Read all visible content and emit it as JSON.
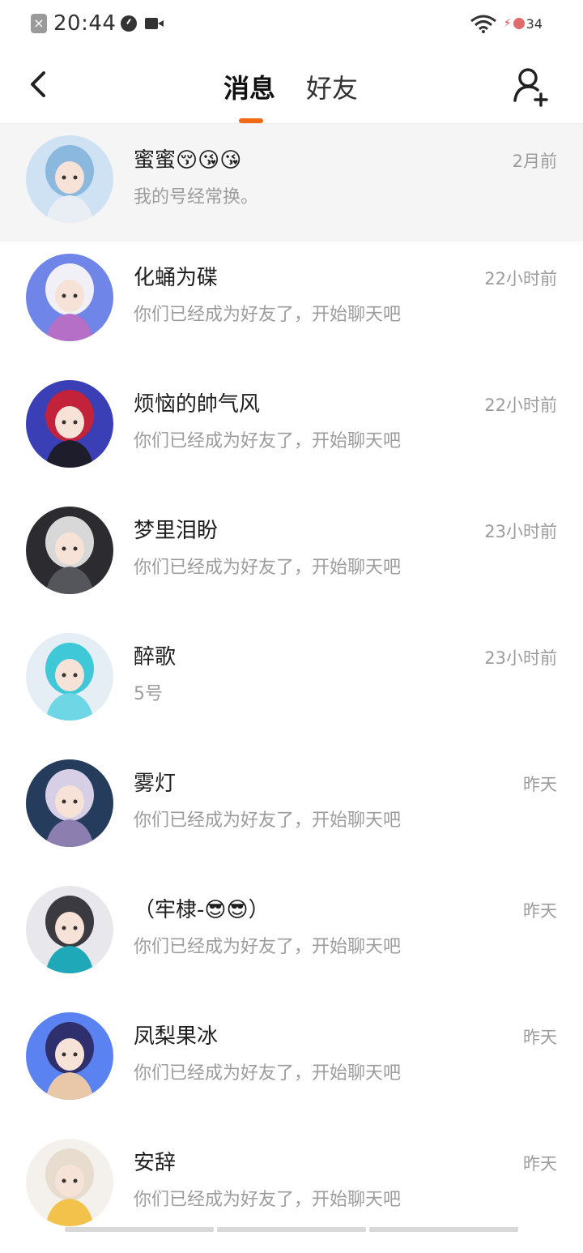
{
  "status_bar": {
    "time": "20:44",
    "battery": "34",
    "icons": [
      "notification-x-icon",
      "clock-icon",
      "video-icon",
      "wifi-icon",
      "charging-icon"
    ]
  },
  "header": {
    "tabs": [
      {
        "label": "消息",
        "active": true
      },
      {
        "label": "好友",
        "active": false
      }
    ],
    "back_icon": "chevron-left-icon",
    "add_icon": "add-friend-icon"
  },
  "accent_color": "#f06a16",
  "conversations": [
    {
      "name": "蜜蜜😚😘😘",
      "preview": "我的号经常换。",
      "time": "2月前",
      "pinned": true,
      "avatar_colors": [
        "#cfe2f4",
        "#8ab8de",
        "#e9eef4"
      ]
    },
    {
      "name": "化蛹为碟",
      "preview": "你们已经成为好友了，开始聊天吧",
      "time": "22小时前",
      "pinned": false,
      "avatar_colors": [
        "#6f86e8",
        "#f0f0f6",
        "#b66fc7"
      ]
    },
    {
      "name": "烦恼的帥气风",
      "preview": "你们已经成为好友了，开始聊天吧",
      "time": "22小时前",
      "pinned": false,
      "avatar_colors": [
        "#3a3fb5",
        "#c2223a",
        "#1d1d2c"
      ]
    },
    {
      "name": "梦里泪盼",
      "preview": "你们已经成为好友了，开始聊天吧",
      "time": "23小时前",
      "pinned": false,
      "avatar_colors": [
        "#2c2c30",
        "#d8d8d8",
        "#55565c"
      ]
    },
    {
      "name": "醉歌",
      "preview": "5号",
      "time": "23小时前",
      "pinned": false,
      "avatar_colors": [
        "#e4eef4",
        "#3ec8d8",
        "#6fd6e6"
      ]
    },
    {
      "name": "雾灯",
      "preview": "你们已经成为好友了，开始聊天吧",
      "time": "昨天",
      "pinned": false,
      "avatar_colors": [
        "#253c5c",
        "#d6cfe6",
        "#8c7fb0"
      ]
    },
    {
      "name": "（牢棣-😎😎）",
      "preview": "你们已经成为好友了，开始聊天吧",
      "time": "昨天",
      "pinned": false,
      "avatar_colors": [
        "#e8e8ec",
        "#3a3a40",
        "#1fa8b8"
      ]
    },
    {
      "name": "凤梨果冰",
      "preview": "你们已经成为好友了，开始聊天吧",
      "time": "昨天",
      "pinned": false,
      "avatar_colors": [
        "#5a82f0",
        "#2f2f6e",
        "#e8c8a8"
      ]
    },
    {
      "name": "安辞",
      "preview": "你们已经成为好友了，开始聊天吧",
      "time": "昨天",
      "pinned": false,
      "avatar_colors": [
        "#f4f0ec",
        "#e8dccf",
        "#f2c24a"
      ]
    }
  ]
}
